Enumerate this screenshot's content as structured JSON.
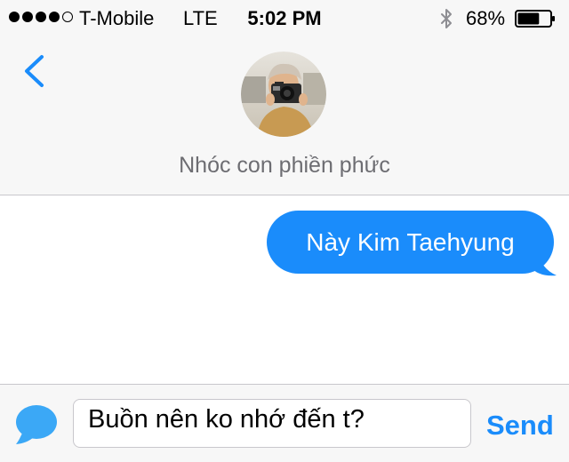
{
  "status_bar": {
    "signal_bars_filled": 4,
    "signal_bars_total": 5,
    "carrier": "T-Mobile",
    "network": "LTE",
    "time": "5:02 PM",
    "battery_percent": "68%",
    "battery_level": 0.68
  },
  "header": {
    "back_icon": "chevron-left-icon",
    "contact_name": "Nhóc con phiền phức"
  },
  "conversation": {
    "messages": [
      {
        "direction": "outgoing",
        "text": "Này Kim Taehyung"
      }
    ]
  },
  "composer": {
    "input_value": "Buồn nên ko nhớ đến t?",
    "send_label": "Send",
    "app_icon": "message-bubble-icon"
  },
  "colors": {
    "accent": "#1a8cfb",
    "header_bg": "#f7f7f7",
    "contact_name": "#6d6d72",
    "separator": "#c8c7cc"
  }
}
